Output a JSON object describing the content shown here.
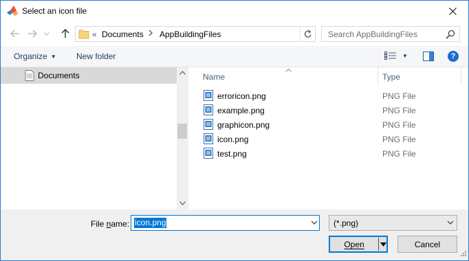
{
  "window": {
    "title": "Select an icon file",
    "app_icon": "matlab-logo-icon",
    "close_icon": "close-icon",
    "accent_color": "#0078d7"
  },
  "nav": {
    "back_icon": "back-arrow-icon",
    "forward_icon": "forward-arrow-icon",
    "recent_icon": "chevron-down-icon",
    "up_icon": "up-arrow-icon"
  },
  "address": {
    "overflow": "«",
    "crumbs": [
      "Documents",
      "AppBuildingFiles"
    ],
    "refresh_icon": "refresh-icon"
  },
  "search": {
    "placeholder": "Search AppBuildingFiles",
    "icon": "search-icon"
  },
  "toolbar": {
    "organize_label": "Organize",
    "new_folder_label": "New folder"
  },
  "navpane": {
    "selected_item": "Documents"
  },
  "filelist": {
    "columns": [
      "Name",
      "Type"
    ],
    "files": [
      {
        "name": "erroricon.png",
        "type": "PNG File"
      },
      {
        "name": "example.png",
        "type": "PNG File"
      },
      {
        "name": "graphicon.png",
        "type": "PNG File"
      },
      {
        "name": "icon.png",
        "type": "PNG File"
      },
      {
        "name": "test.png",
        "type": "PNG File"
      }
    ]
  },
  "bottom": {
    "filename_label_prefix": "File ",
    "filename_label_underline": "n",
    "filename_label_suffix": "ame:",
    "filename_value": "icon.png",
    "filetype_value": "(*.png)",
    "open_label": "Open",
    "cancel_label": "Cancel"
  }
}
